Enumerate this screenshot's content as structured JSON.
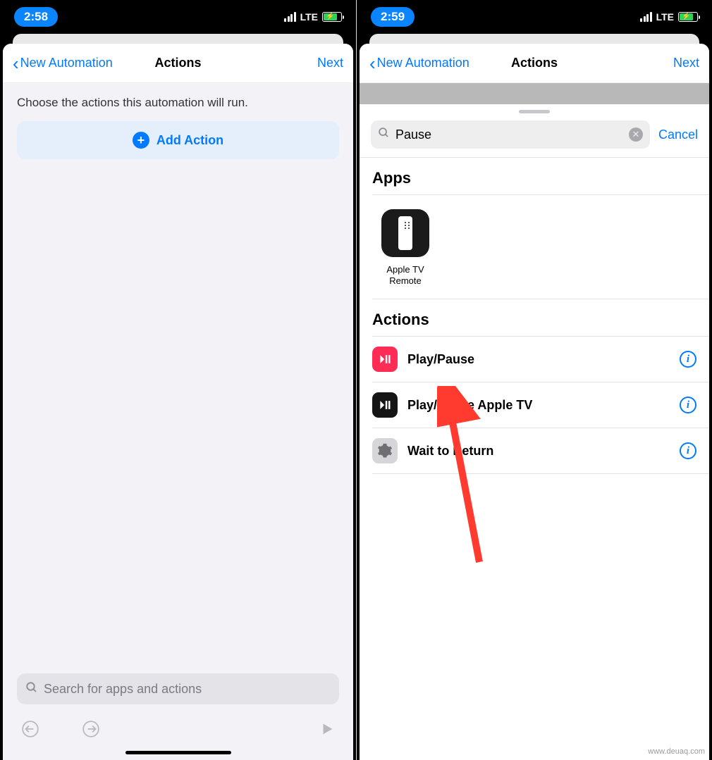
{
  "left": {
    "status": {
      "time": "2:58",
      "network": "LTE"
    },
    "nav": {
      "back": "New Automation",
      "title": "Actions",
      "next": "Next"
    },
    "hint": "Choose the actions this automation will run.",
    "addAction": "Add Action",
    "searchPlaceholder": "Search for apps and actions"
  },
  "right": {
    "status": {
      "time": "2:59",
      "network": "LTE"
    },
    "nav": {
      "back": "New Automation",
      "title": "Actions",
      "next": "Next"
    },
    "search": {
      "value": "Pause",
      "cancel": "Cancel"
    },
    "sections": {
      "apps": {
        "title": "Apps",
        "items": [
          {
            "label": "Apple TV Remote"
          }
        ]
      },
      "actions": {
        "title": "Actions",
        "items": [
          {
            "label": "Play/Pause",
            "iconColor": "pink"
          },
          {
            "label": "Play/Pause Apple TV",
            "iconColor": "black"
          },
          {
            "label": "Wait to Return",
            "iconColor": "gray"
          }
        ]
      }
    }
  },
  "watermark": "www.deuaq.com"
}
